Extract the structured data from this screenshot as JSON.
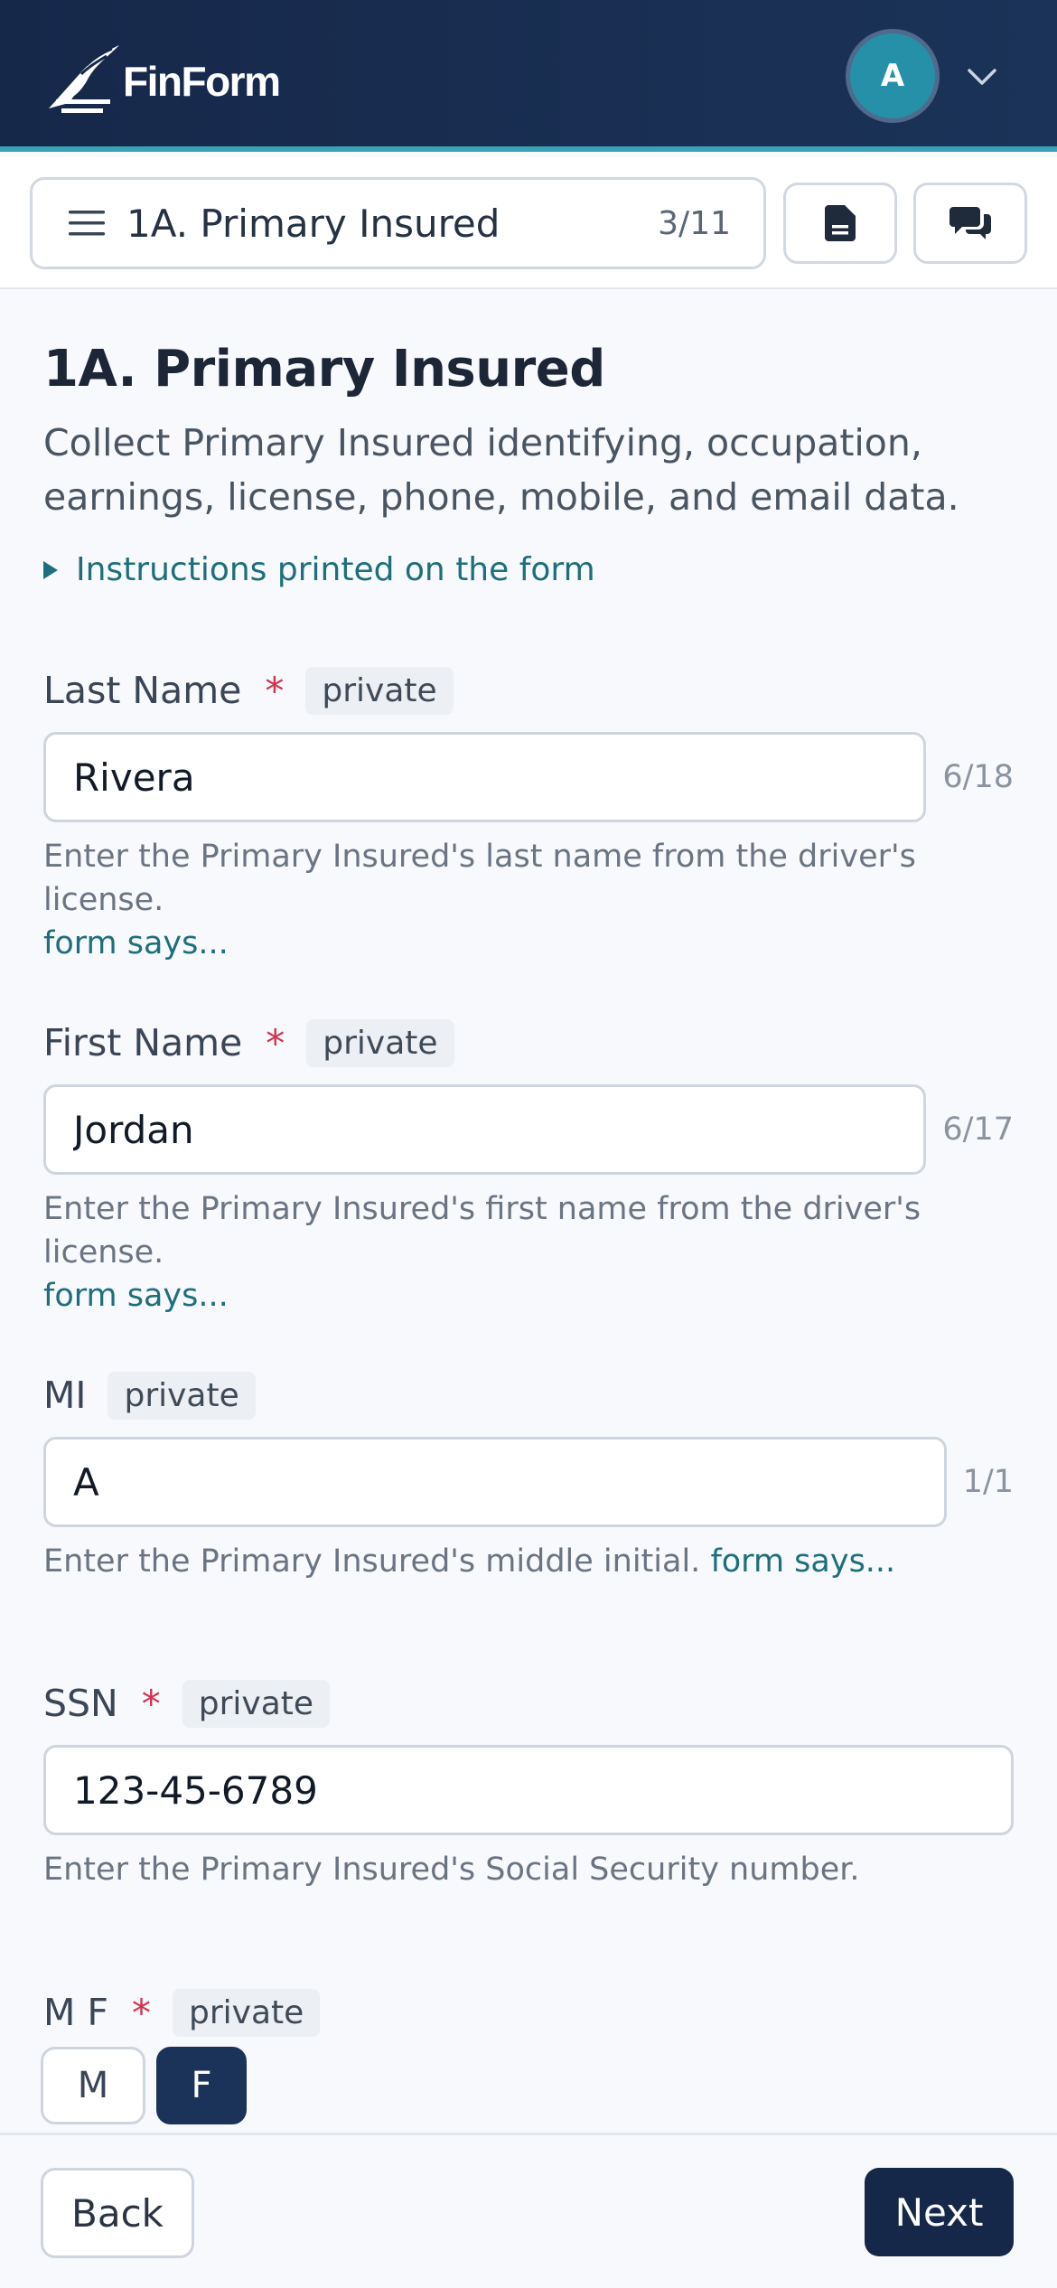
{
  "app": {
    "name": "FinForm",
    "avatar_initial": "A"
  },
  "nav": {
    "section_title": "1A. Primary Insured",
    "section_count": "3/11"
  },
  "section": {
    "title": "1A. Primary Insured",
    "description": "Collect Primary Insured identifying, occupation, earnings, license, phone, mobile, and email data.",
    "instructions_link": "Instructions printed on the form"
  },
  "fields": {
    "last_name": {
      "label": "Last Name",
      "required_mark": "*",
      "tag": "private",
      "value": "Rivera",
      "counter": "6/18",
      "helper": "Enter the Primary Insured's last name from the driver's license.",
      "link": "form says..."
    },
    "first_name": {
      "label": "First Name",
      "required_mark": "*",
      "tag": "private",
      "value": "Jordan",
      "counter": "6/17",
      "helper": "Enter the Primary Insured's first name from the driver's license.",
      "link": "form says..."
    },
    "mi": {
      "label": "MI",
      "tag": "private",
      "value": "A",
      "counter": "1/1",
      "helper": "Enter the Primary Insured's middle initial.",
      "link": "form says..."
    },
    "ssn": {
      "label": "SSN",
      "required_mark": "*",
      "tag": "private",
      "value": "123-45-6789",
      "helper": "Enter the Primary Insured's Social Security number."
    },
    "sex": {
      "label": "M F",
      "required_mark": "*",
      "tag": "private",
      "options": [
        "M",
        "F"
      ],
      "selected": "F"
    }
  },
  "footer": {
    "back_label": "Back",
    "next_label": "Next"
  },
  "colors": {
    "header_bg": "#16284a",
    "accent_teal": "#1e6f7d",
    "avatar": "#2590a8",
    "required": "#d4314e",
    "primary_button": "#16284a"
  },
  "icons": [
    "finform-logo-icon",
    "chevron-down-icon",
    "menu-icon",
    "document-icon",
    "chat-icon",
    "triangle-right-icon"
  ]
}
